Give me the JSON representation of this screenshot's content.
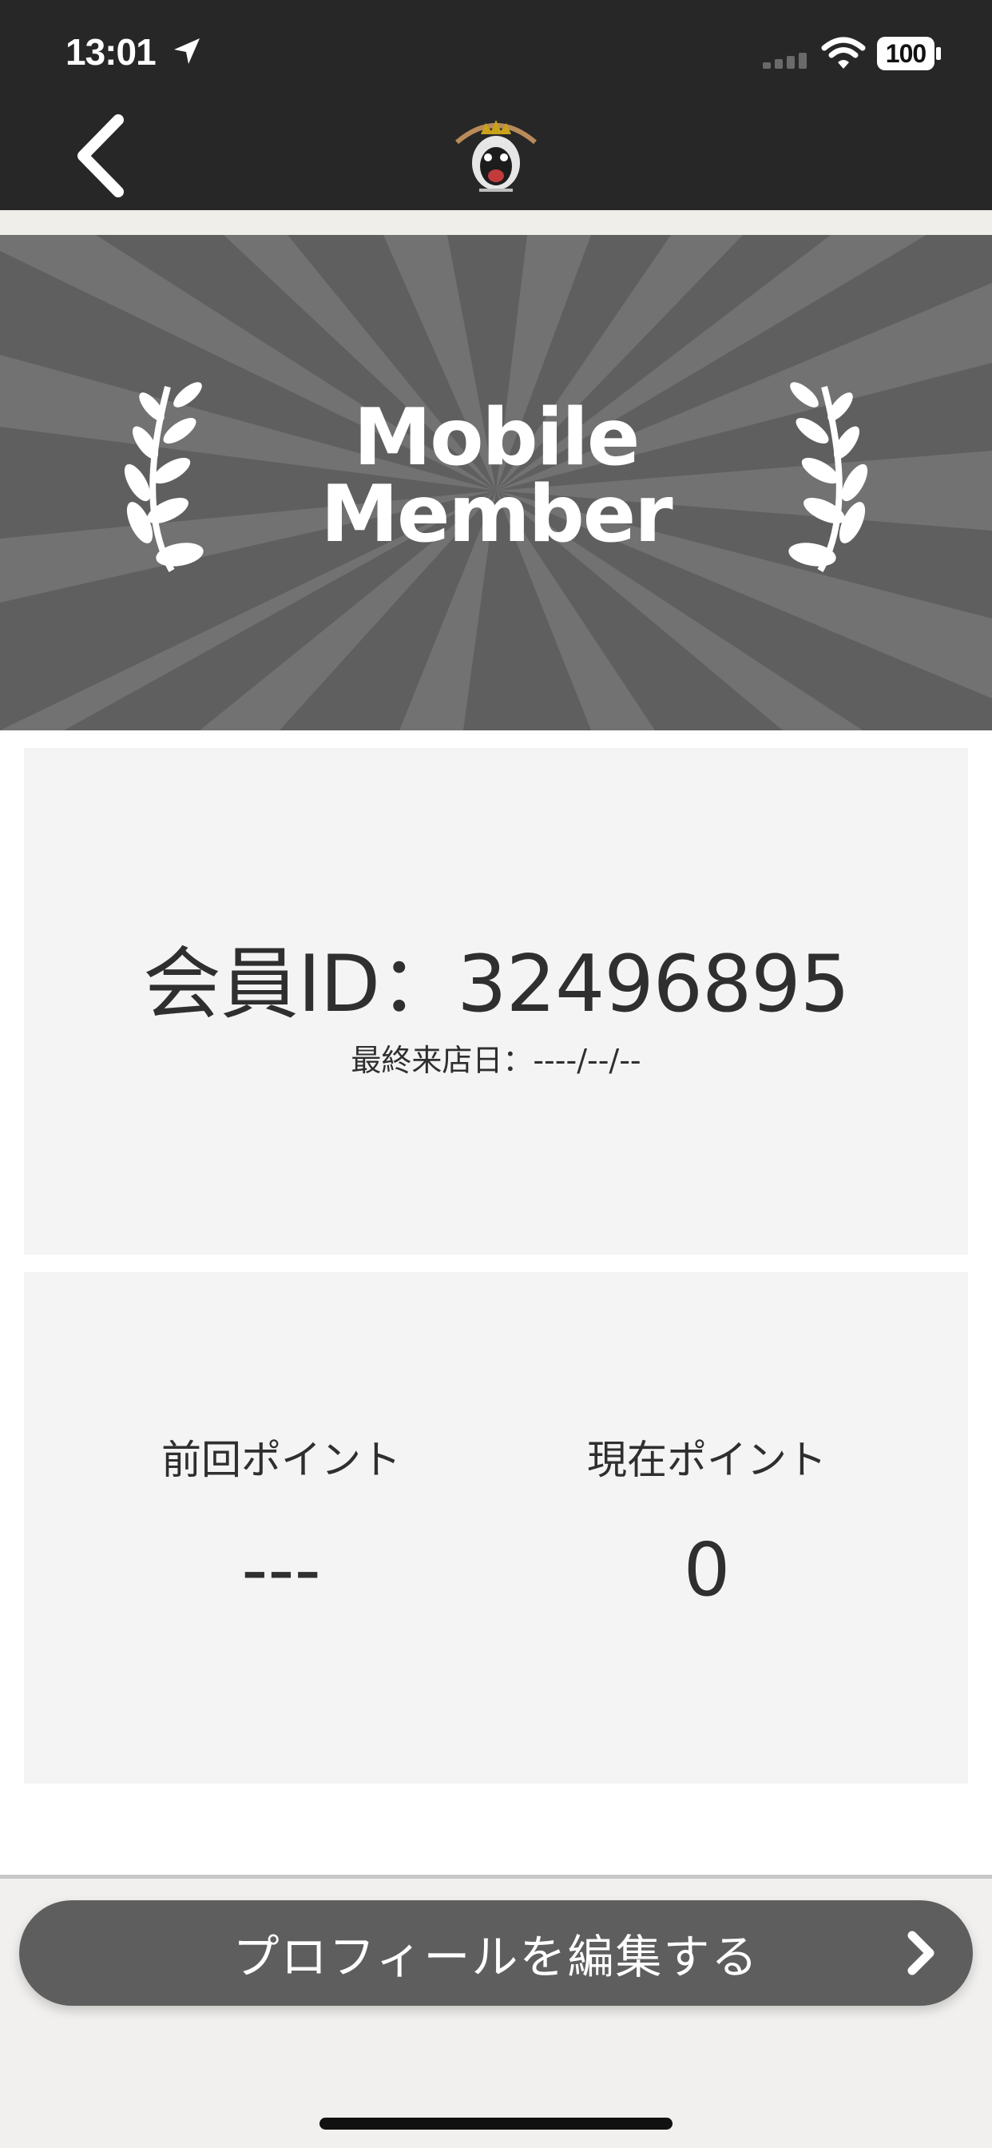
{
  "status_bar": {
    "time": "13:01",
    "battery": "100"
  },
  "header": {
    "back_icon": "chevron-left-icon",
    "logo_icon": "gorilla-logo-icon"
  },
  "hero": {
    "title_line1": "Mobile",
    "title_line2": "Member",
    "left_decoration": "laurel-branch-icon",
    "right_decoration": "laurel-branch-icon"
  },
  "member": {
    "id_text": "会員ID：32496895",
    "last_visit": "最終来店日：----/--/--"
  },
  "points": {
    "previous_label": "前回ポイント",
    "previous_value": "---",
    "current_label": "現在ポイント",
    "current_value": "0"
  },
  "footer": {
    "edit_profile_label": "プロフィールを編集する",
    "edit_icon": "chevron-right-icon"
  },
  "colors": {
    "header_bg": "#272727",
    "hero_bg": "#5f5f5f",
    "card_bg": "#f4f4f4",
    "button_bg": "#5e5e5e"
  }
}
